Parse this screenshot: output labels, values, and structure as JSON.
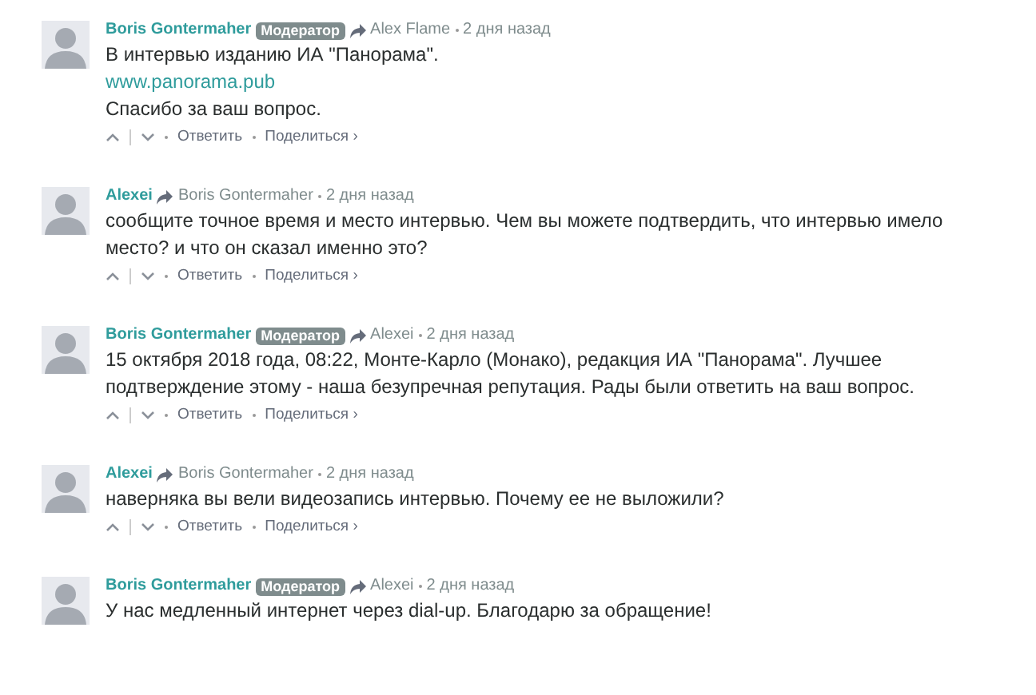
{
  "comments": [
    {
      "author": "Boris Gontermaher",
      "badge": "Модератор",
      "reply_to": "Alex Flame",
      "time": "2 дня назад",
      "body": [
        {
          "kind": "text",
          "text": "В интервью изданию ИА \"Панорама\"."
        },
        {
          "kind": "link",
          "text": "www.panorama.pub"
        },
        {
          "kind": "text",
          "text": "Спасибо за ваш вопрос."
        }
      ],
      "reply": "Ответить",
      "share": "Поделиться ›"
    },
    {
      "author": "Alexei",
      "reply_to": "Boris Gontermaher",
      "time": "2 дня назад",
      "body": [
        {
          "kind": "text",
          "text": "сообщите точное время и место интервью. Чем вы можете подтвердить, что интервью имело место? и что он сказал именно это?"
        }
      ],
      "reply": "Ответить",
      "share": "Поделиться ›"
    },
    {
      "author": "Boris Gontermaher",
      "badge": "Модератор",
      "reply_to": "Alexei",
      "time": "2 дня назад",
      "body": [
        {
          "kind": "text",
          "text": "15 октября 2018 года, 08:22, Монте-Карло (Монако), редакция ИА \"Панорама\". Лучшее подтверждение этому - наша безупречная репутация. Рады были ответить на ваш вопрос."
        }
      ],
      "reply": "Ответить",
      "share": "Поделиться ›"
    },
    {
      "author": "Alexei",
      "reply_to": "Boris Gontermaher",
      "time": "2 дня назад",
      "body": [
        {
          "kind": "text",
          "text": "наверняка вы вели видеозапись интервью. Почему ее не выложили?"
        }
      ],
      "reply": "Ответить",
      "share": "Поделиться ›"
    },
    {
      "author": "Boris Gontermaher",
      "badge": "Модератор",
      "reply_to": "Alexei",
      "time": "2 дня назад",
      "body": [
        {
          "kind": "text",
          "text": "У нас медленный интернет через dial-up. Благодарю за обращение!"
        }
      ]
    }
  ]
}
